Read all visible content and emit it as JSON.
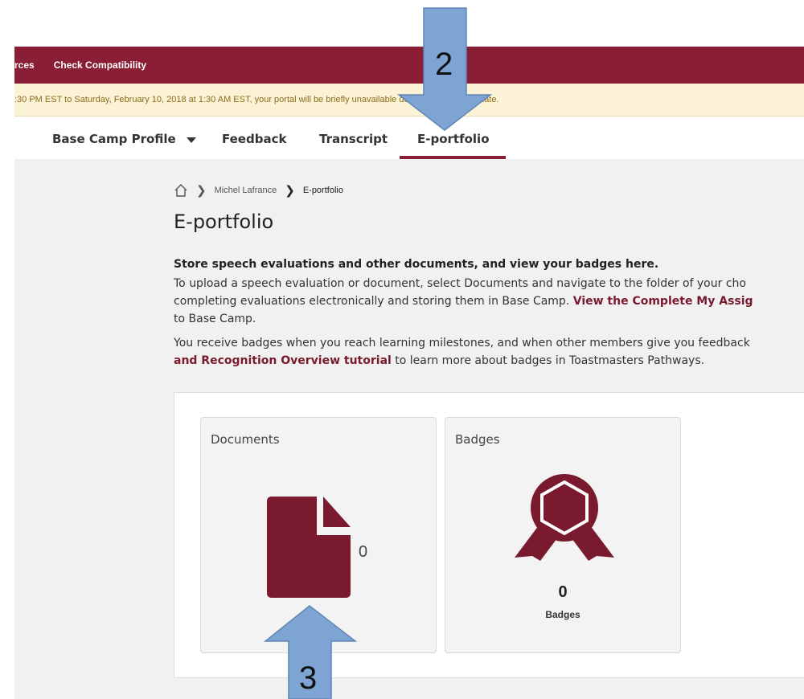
{
  "topnav": {
    "items": [
      "rces",
      "Check Compatibility"
    ]
  },
  "banner": {
    "text": ":30 PM EST to Saturday, February 10, 2018 at 1:30 AM EST, your portal will be briefly unavailable due to a software update."
  },
  "tabs": [
    {
      "label": "Base Camp Profile",
      "active": false,
      "has_dropdown": true
    },
    {
      "label": "Feedback",
      "active": false
    },
    {
      "label": "Transcript",
      "active": false
    },
    {
      "label": "E-portfolio",
      "active": true
    }
  ],
  "breadcrumb": {
    "items": [
      "Michel Lafrance",
      "E-portfolio"
    ]
  },
  "page_title": "E-portfolio",
  "intro": {
    "lead": "Store speech evaluations and other documents, and view your badges here.",
    "p1_line1": "To upload a speech evaluation or document, select Documents and navigate to the folder of your cho",
    "p1_line2_text": "completing evaluations electronically and storing them in Base Camp. ",
    "p1_link": "View the Complete My Assig",
    "p1_line3": "to Base Camp.",
    "p2_line1": "You receive badges when you reach learning milestones, and when other members give you feedback",
    "p2_link": "and Recognition Overview tutorial",
    "p2_rest": " to learn more about badges in Toastmasters Pathways."
  },
  "cards": {
    "documents": {
      "title": "Documents",
      "count": "0"
    },
    "badges": {
      "title": "Badges",
      "count": "0",
      "label": "Badges"
    }
  },
  "annotations": {
    "arrow_top_label": "2",
    "arrow_bottom_label": "3"
  },
  "colors": {
    "brand": "#8a1e34",
    "icon": "#7a1a2e",
    "banner_bg": "#fcf2d6",
    "arrow": "#7ea4d3"
  }
}
